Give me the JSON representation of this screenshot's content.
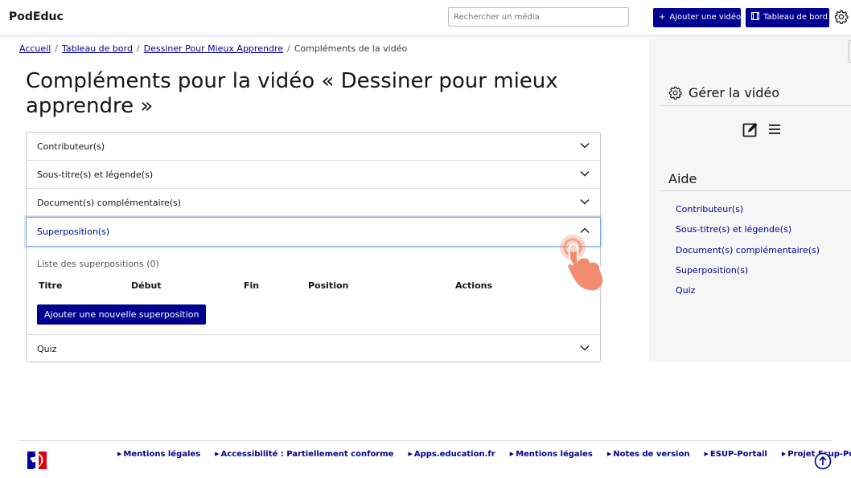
{
  "header": {
    "brand": "PodEduc",
    "search_placeholder": "Rechercher un média",
    "add_video_label": "Ajouter une vidéo",
    "dashboard_label": "Tableau de bord",
    "add_icon": "plus-icon",
    "dashboard_icon": "film-icon",
    "settings_icon": "gear-icon"
  },
  "breadcrumb": {
    "items": [
      "Accueil",
      "Tableau de bord",
      "Dessiner Pour Mieux Apprendre"
    ],
    "current": "Compléments de la vidéo",
    "separator": "/"
  },
  "page": {
    "title": "Compléments pour la vidéo « Dessiner pour mieux apprendre »"
  },
  "accordion": {
    "items": [
      {
        "label": "Contributeur(s)",
        "open": false
      },
      {
        "label": "Sous-titre(s) et légende(s)",
        "open": false
      },
      {
        "label": "Document(s) complémentaire(s)",
        "open": false
      },
      {
        "label": "Superposition(s)",
        "open": true
      },
      {
        "label": "Quiz",
        "open": false
      }
    ],
    "overlay_panel": {
      "caption": "Liste des superpositions (0)",
      "columns": [
        "Titre",
        "Début",
        "Fin",
        "Position",
        "Actions"
      ],
      "add_button": "Ajouter une nouvelle superposition"
    }
  },
  "sidebar": {
    "manage_title": "Gérer la vidéo",
    "manage_icon": "gear-icon",
    "tools": [
      "edit-icon",
      "list-icon"
    ],
    "help_title": "Aide",
    "help_links": [
      "Contributeur(s)",
      "Sous-titre(s) et légende(s)",
      "Document(s) complémentaire(s)",
      "Superposition(s)",
      "Quiz"
    ]
  },
  "footer": {
    "links": [
      "Mentions légales",
      "Accessibilité : Partiellement conforme",
      "Apps.education.fr",
      "Mentions légales",
      "Notes de version",
      "ESUP-Portail",
      "Projet Esup-Pod"
    ],
    "back_to_top_icon": "arrow-up-circle-icon",
    "logo": "republique-francaise-logo"
  },
  "colors": {
    "primary": "#000091",
    "accent_red": "#e1000f",
    "sidebar_bg": "#f6f6f6",
    "hand": "#f28b6f"
  }
}
